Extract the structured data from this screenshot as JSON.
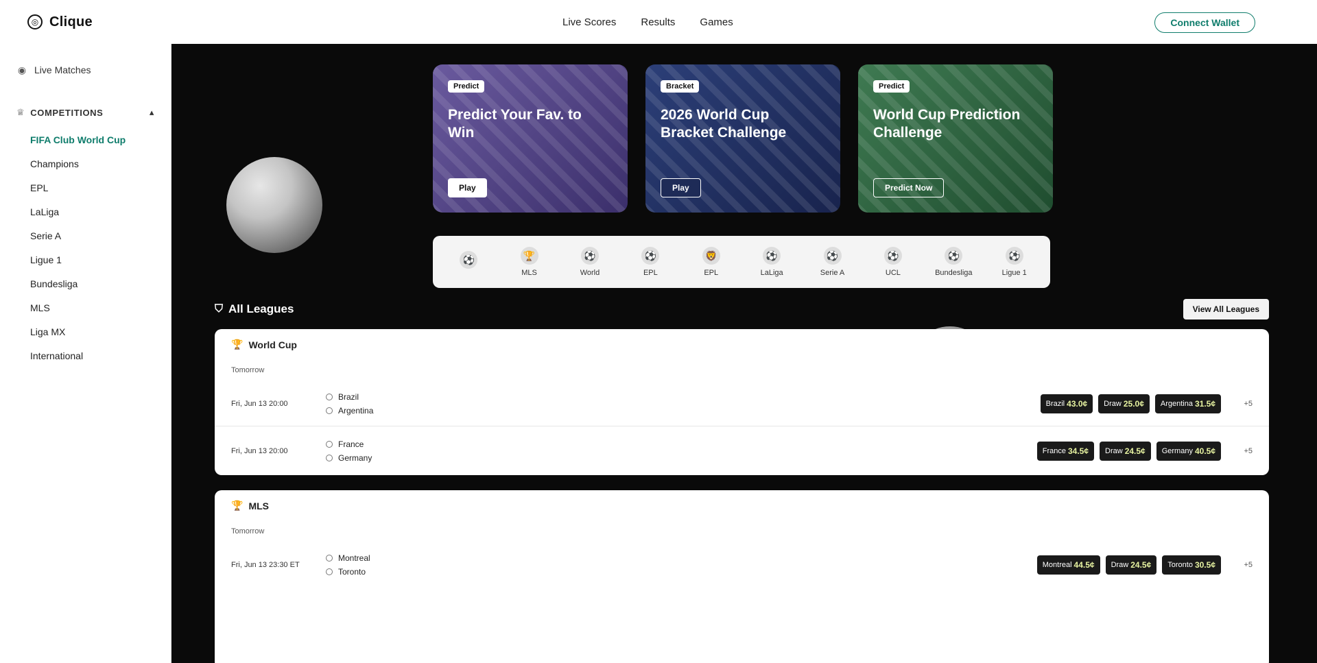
{
  "app": {
    "name": "Clique"
  },
  "topnav": [
    "Live Scores",
    "Results",
    "Games"
  ],
  "connect_label": "Connect Wallet",
  "sidebar": {
    "home_label": "Live Matches",
    "section_label": "COMPETITIONS",
    "items": [
      "FIFA Club World Cup",
      "Champions",
      "EPL",
      "LaLiga",
      "Serie A",
      "Ligue 1",
      "Bundesliga",
      "MLS",
      "Liga MX",
      "International"
    ]
  },
  "promos": [
    {
      "badge": "Predict",
      "title": "Predict Your Fav. to Win",
      "button": "Play"
    },
    {
      "badge": "Bracket",
      "title": "2026 World Cup Bracket Challenge",
      "button": "Play"
    },
    {
      "badge": "Predict",
      "title": "World Cup Prediction Challenge",
      "button": "Predict Now"
    }
  ],
  "leagues": [
    {
      "icon": "⚽",
      "label": ""
    },
    {
      "icon": "🏆",
      "label": "MLS"
    },
    {
      "icon": "⚽",
      "label": "World"
    },
    {
      "icon": "⚽",
      "label": "EPL"
    },
    {
      "icon": "🦁",
      "label": "EPL"
    },
    {
      "icon": "⚽",
      "label": "LaLiga"
    },
    {
      "icon": "⚽",
      "label": "Serie A"
    },
    {
      "icon": "⚽",
      "label": "UCL"
    },
    {
      "icon": "⚽",
      "label": "Bundesliga"
    },
    {
      "icon": "⚽",
      "label": "Ligue 1"
    }
  ],
  "section": {
    "title": "All Leagues",
    "view_all": "View All Leagues"
  },
  "cards": [
    {
      "title": "World Cup",
      "subtitle": "Tomorrow",
      "matches": [
        {
          "time": "Fri, Jun 13 20:00",
          "team1": "Brazil",
          "team2": "Argentina",
          "odds": [
            {
              "label": "Brazil",
              "price": "43.0¢"
            },
            {
              "label": "Draw",
              "price": "25.0¢"
            },
            {
              "label": "Argentina",
              "price": "31.5¢"
            }
          ],
          "more": "+5"
        },
        {
          "time": "Fri, Jun 13 20:00",
          "team1": "France",
          "team2": "Germany",
          "odds": [
            {
              "label": "France",
              "price": "34.5¢"
            },
            {
              "label": "Draw",
              "price": "24.5¢"
            },
            {
              "label": "Germany",
              "price": "40.5¢"
            }
          ],
          "more": "+5"
        }
      ]
    },
    {
      "title": "MLS",
      "subtitle": "Tomorrow",
      "matches": [
        {
          "time": "Fri, Jun 13 23:30 ET",
          "team1": "Montreal",
          "team2": "Toronto",
          "odds": [
            {
              "label": "Montreal",
              "price": "44.5¢"
            },
            {
              "label": "Draw",
              "price": "24.5¢"
            },
            {
              "label": "Toronto",
              "price": "30.5¢"
            }
          ],
          "more": "+5"
        }
      ]
    }
  ]
}
